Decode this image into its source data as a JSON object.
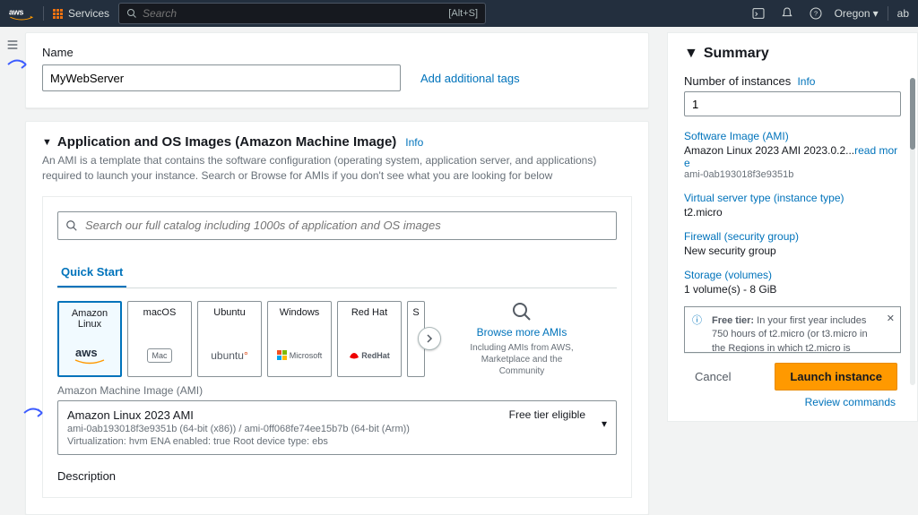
{
  "topnav": {
    "services_label": "Services",
    "search_placeholder": "Search",
    "search_shortcut": "[Alt+S]",
    "region": "Oregon",
    "account_fragment": "ab"
  },
  "name_section": {
    "label": "Name",
    "value": "MyWebServer",
    "add_tags_link": "Add additional tags"
  },
  "ami_section": {
    "title": "Application and OS Images (Amazon Machine Image)",
    "info_link": "Info",
    "subtitle": "An AMI is a template that contains the software configuration (operating system, application server, and applications) required to launch your instance. Search or Browse for AMIs if you don't see what you are looking for below",
    "catalog_placeholder": "Search our full catalog including 1000s of application and OS images",
    "tab_quickstart": "Quick Start",
    "os_tiles": [
      {
        "name": "Amazon Linux",
        "logo_text": "aws",
        "selected": true
      },
      {
        "name": "macOS",
        "logo_text": "Mac",
        "selected": false
      },
      {
        "name": "Ubuntu",
        "logo_text": "ubuntu",
        "selected": false
      },
      {
        "name": "Windows",
        "logo_text": "Microsoft",
        "selected": false
      },
      {
        "name": "Red Hat",
        "logo_text": "RedHat",
        "selected": false
      },
      {
        "name": "S",
        "logo_text": "",
        "selected": false
      }
    ],
    "browse_more": "Browse more AMIs",
    "browse_sub": "Including AMIs from AWS, Marketplace and the Community",
    "ami_label": "Amazon Machine Image (AMI)",
    "selected_ami": {
      "title": "Amazon Linux 2023 AMI",
      "free_tier": "Free tier eligible",
      "line1": "ami-0ab193018f3e9351b (64-bit (x86)) / ami-0ff068fe74ee15b7b (64-bit (Arm))",
      "line2": "Virtualization: hvm    ENA enabled: true    Root device type: ebs"
    },
    "description_h": "Description"
  },
  "summary": {
    "title": "Summary",
    "num_instances_label": "Number of instances",
    "num_instances_info": "Info",
    "num_instances_value": "1",
    "software_image_h": "Software Image (AMI)",
    "software_image_val": "Amazon Linux 2023 AMI 2023.0.2...",
    "software_image_read_more": "read more",
    "software_image_ami": "ami-0ab193018f3e9351b",
    "instance_type_h": "Virtual server type (instance type)",
    "instance_type_val": "t2.micro",
    "firewall_h": "Firewall (security group)",
    "firewall_val": "New security group",
    "storage_h": "Storage (volumes)",
    "storage_val": "1 volume(s) - 8 GiB",
    "free_tier_label": "Free tier:",
    "free_tier_text": " In your first year includes 750 hours of t2.micro (or t3.micro in the Regions in which t2.micro is",
    "cancel": "Cancel",
    "launch": "Launch instance",
    "review": "Review commands"
  }
}
